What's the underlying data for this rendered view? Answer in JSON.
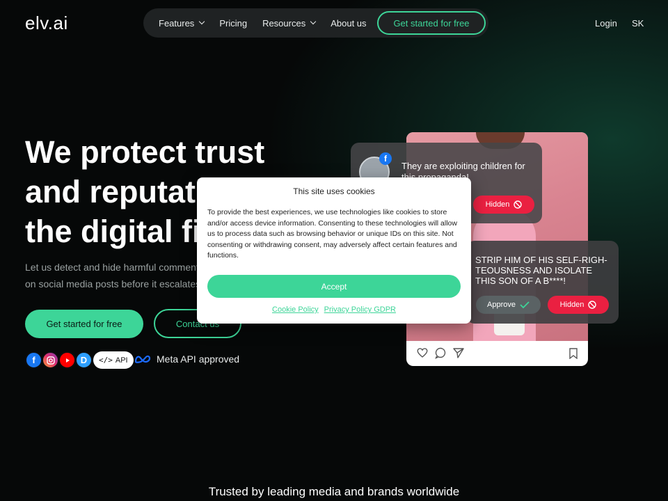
{
  "brand": {
    "logo": "elv.ai",
    "accent": "#3dd598"
  },
  "nav": {
    "items": [
      {
        "label": "Features",
        "dropdown": true
      },
      {
        "label": "Pricing",
        "dropdown": false
      },
      {
        "label": "Resources",
        "dropdown": true
      },
      {
        "label": "About us",
        "dropdown": false
      }
    ],
    "cta": "Get started for free",
    "login": "Login",
    "lang": "SK"
  },
  "hero": {
    "headline_line1": "We protect trust",
    "headline_line2": "and reputation in",
    "headline_line3": "the digital field",
    "subtext": "Let us detect and hide harmful comments on social media posts before it escalates",
    "primary_cta": "Get started for free",
    "secondary_cta": "Contact us",
    "api_label": "API",
    "meta_badge": "Meta API approved",
    "social_icons": [
      "facebook-icon",
      "instagram-icon",
      "youtube-icon",
      "disqus-icon"
    ]
  },
  "illustration": {
    "comment1_text": "They are exploiting children for this propaganda!",
    "comment1_status": "Hidden",
    "comment2_text": "STRIP HIM OF HIS SELF-RIGH-TEOUSNESS AND ISOLATE THIS SON OF A B****!",
    "approve_label": "Approve",
    "comment2_status": "Hidden"
  },
  "cookie": {
    "title": "This site uses cookies",
    "body": "To provide the best experiences, we use technologies like cookies to store and/or access device information. Consenting to these technologies will allow us to process data such as browsing behavior or unique IDs on this site. Not consenting or withdrawing consent, may adversely affect certain features and functions.",
    "accept": "Accept",
    "cookie_policy": "Cookie Policy",
    "privacy_policy": "Privacy Policy GDPR"
  },
  "trusted": "Trusted by leading media and brands worldwide"
}
